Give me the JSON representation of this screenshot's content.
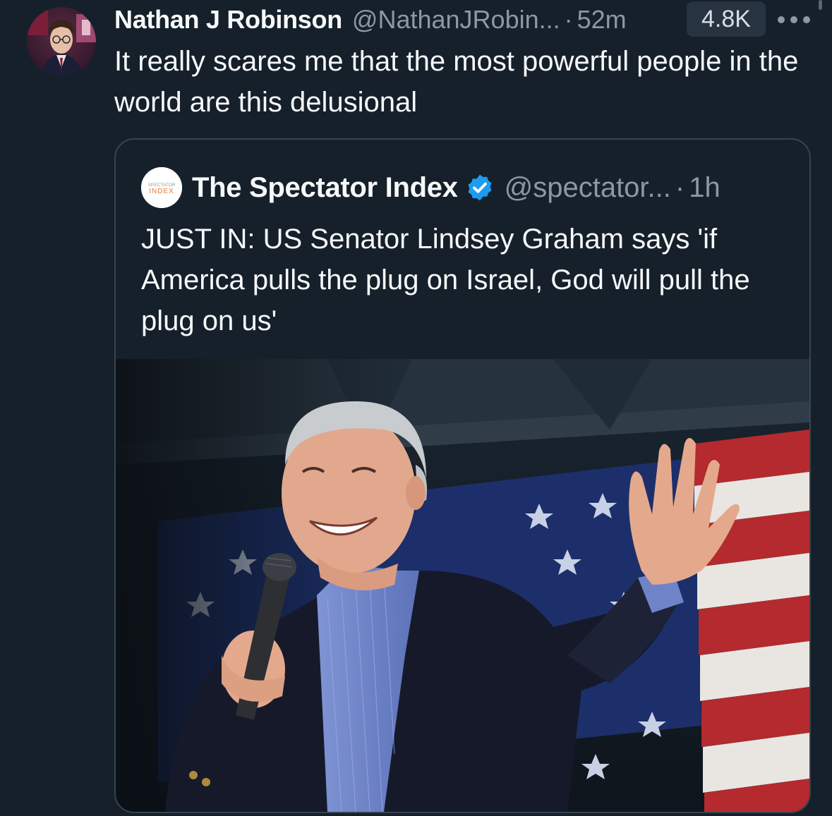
{
  "tweet": {
    "display_name": "Nathan J Robinson",
    "handle": "@NathanJRobin...",
    "separator": "·",
    "time": "52m",
    "views": "4.8K",
    "text": "It really scares me that the most powerful people in the world are this delusional",
    "avatar_icon": "profile-photo"
  },
  "quote": {
    "display_name": "The Spectator Index",
    "handle": "@spectator...",
    "separator": "·",
    "time": "1h",
    "verified": true,
    "verified_color": "#1d9bf0",
    "logo_text_top": "SPECTATOR",
    "logo_text_bottom": "INDEX",
    "text": "JUST IN: US Senator Lindsey Graham says 'if America pulls the plug on Israel, God will pull the plug on us'",
    "media_icon": "photo-man-with-microphone-before-us-flag"
  },
  "colors": {
    "background": "#15202b",
    "primary_text": "#f7f9f9",
    "secondary_text": "#8b98a5",
    "border": "#38444d",
    "badge_bg": "#273340"
  }
}
